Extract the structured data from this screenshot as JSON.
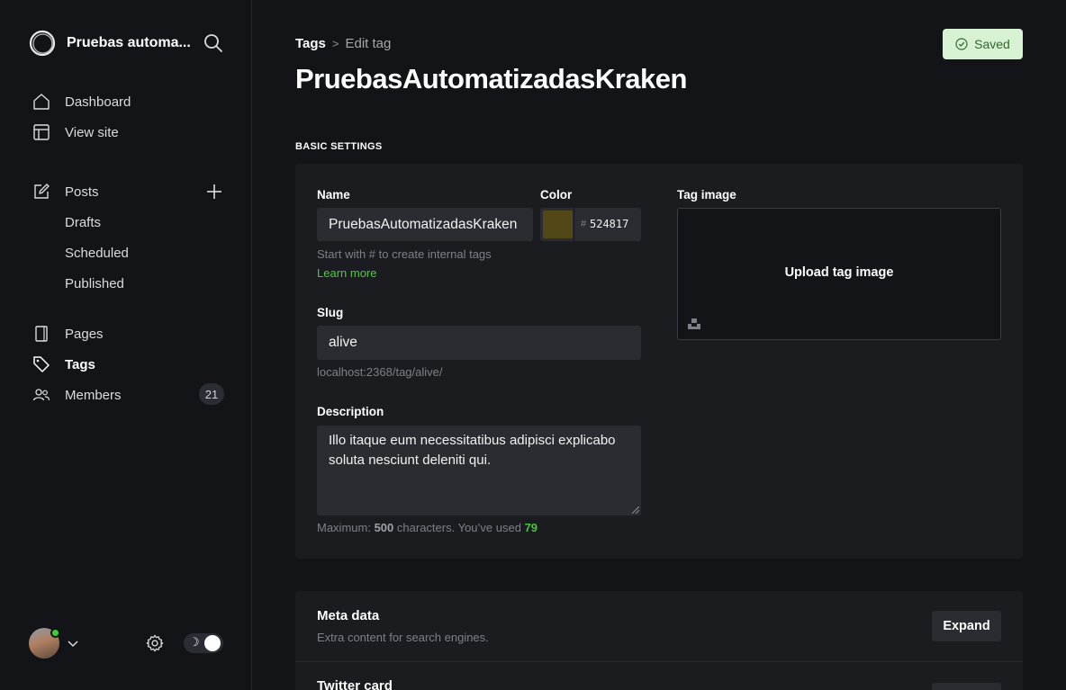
{
  "sidebar": {
    "site_name": "Pruebas automa...",
    "nav": {
      "dashboard": "Dashboard",
      "view_site": "View site",
      "posts": "Posts",
      "drafts": "Drafts",
      "scheduled": "Scheduled",
      "published": "Published",
      "pages": "Pages",
      "tags": "Tags",
      "members": "Members",
      "members_count": "21"
    }
  },
  "header": {
    "breadcrumb_parent": "Tags",
    "breadcrumb_current": "Edit tag",
    "title": "PruebasAutomatizadasKraken",
    "saved_label": "Saved"
  },
  "basic": {
    "section_title": "BASIC SETTINGS",
    "name_label": "Name",
    "name_value": "PruebasAutomatizadasKraken",
    "name_hint": "Start with # to create internal tags",
    "learn_more": "Learn more",
    "color_label": "Color",
    "color_hash": "#",
    "color_value": "524817",
    "color_swatch": "#524817",
    "slug_label": "Slug",
    "slug_value": "alive",
    "slug_url": "localhost:2368/tag/alive/",
    "description_label": "Description",
    "description_value": "Illo itaque eum necessitatibus adipisci explicabo soluta nesciunt deleniti qui.",
    "desc_hint_prefix": "Maximum:",
    "desc_max": "500",
    "desc_hint_mid": "characters. You’ve used",
    "desc_used": "79",
    "tag_image_label": "Tag image",
    "upload_label": "Upload tag image"
  },
  "meta": {
    "title": "Meta data",
    "subtitle": "Extra content for search engines.",
    "expand_label": "Expand",
    "twitter_title": "Twitter card"
  },
  "colors": {
    "background": "#131417",
    "card": "#1a1c20",
    "accent_green": "#4ec23f",
    "saved_bg": "#d6f2d3"
  }
}
